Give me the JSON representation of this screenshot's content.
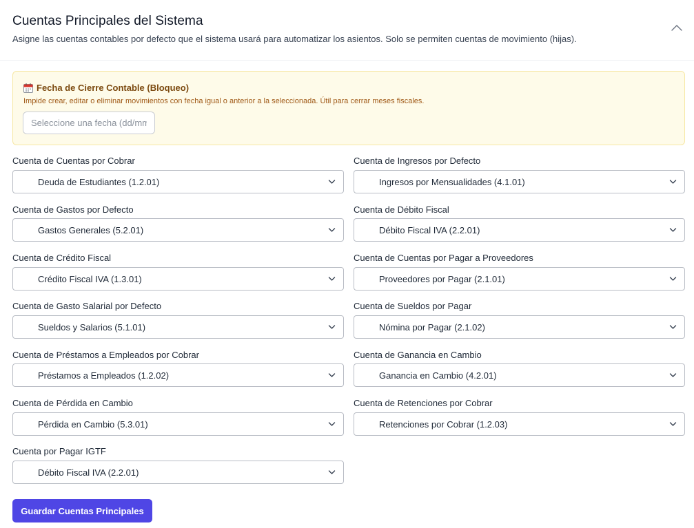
{
  "header": {
    "title": "Cuentas Principales del Sistema",
    "subtitle": "Asigne las cuentas contables por defecto que el sistema usará para automatizar los asientos. Solo se permiten cuentas de movimiento (hijas).",
    "collapse_icon": "chevron-up-icon"
  },
  "lock": {
    "icon": "calendar-icon",
    "title": "Fecha de Cierre Contable (Bloqueo)",
    "description": "Impide crear, editar o eliminar movimientos con fecha igual o anterior a la seleccionada. Útil para cerrar meses fiscales.",
    "date_placeholder": "Seleccione una fecha (dd/mm/aaaa)",
    "date_value": ""
  },
  "fields": {
    "cxc": {
      "label": "Cuenta de Cuentas por Cobrar",
      "value": "Deuda de Estudiantes (1.2.01)"
    },
    "ingresos": {
      "label": "Cuenta de Ingresos por Defecto",
      "value": "Ingresos por Mensualidades (4.1.01)"
    },
    "gastos": {
      "label": "Cuenta de Gastos por Defecto",
      "value": "Gastos Generales (5.2.01)"
    },
    "debito_fiscal": {
      "label": "Cuenta de Débito Fiscal",
      "value": "Débito Fiscal IVA (2.2.01)"
    },
    "credito_fiscal": {
      "label": "Cuenta de Crédito Fiscal",
      "value": "Crédito Fiscal IVA (1.3.01)"
    },
    "cxp_proveedores": {
      "label": "Cuenta de Cuentas por Pagar a Proveedores",
      "value": "Proveedores por Pagar (2.1.01)"
    },
    "gasto_salarial": {
      "label": "Cuenta de Gasto Salarial por Defecto",
      "value": "Sueldos y Salarios (5.1.01)"
    },
    "sueldos_pagar": {
      "label": "Cuenta de Sueldos por Pagar",
      "value": "Nómina por Pagar (2.1.02)"
    },
    "prestamos": {
      "label": "Cuenta de Préstamos a Empleados por Cobrar",
      "value": "Préstamos a Empleados (1.2.02)"
    },
    "ganancia_cambio": {
      "label": "Cuenta de Ganancia en Cambio",
      "value": "Ganancia en Cambio (4.2.01)"
    },
    "perdida_cambio": {
      "label": "Cuenta de Pérdida en Cambio",
      "value": "Pérdida en Cambio (5.3.01)"
    },
    "retenciones": {
      "label": "Cuenta de Retenciones por Cobrar",
      "value": "Retenciones por Cobrar (1.2.03)"
    },
    "igtf": {
      "label": "Cuenta por Pagar IGTF",
      "value": "Débito Fiscal IVA (2.2.01)"
    }
  },
  "actions": {
    "save_label": "Guardar Cuentas Principales"
  },
  "colors": {
    "accent": "#4f46e5",
    "warning_bg": "#fefbe9",
    "warning_border": "#f6e7a3",
    "warning_title": "#7c4a10",
    "warning_text": "#a05a18"
  }
}
